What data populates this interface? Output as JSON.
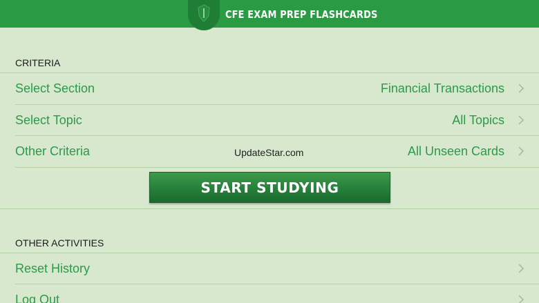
{
  "header": {
    "title": "CFE EXAM PREP FLASHCARDS",
    "logo_icon": "shield-logo-icon"
  },
  "criteria": {
    "heading": "CRITERIA",
    "rows": [
      {
        "label": "Select Section",
        "value": "Financial Transactions"
      },
      {
        "label": "Select Topic",
        "value": "All Topics"
      },
      {
        "label": "Other Criteria",
        "value": "All Unseen Cards"
      }
    ],
    "watermark": "UpdateStar.com",
    "start_button": "START STUDYING"
  },
  "other_activities": {
    "heading": "OTHER ACTIVITIES",
    "rows": [
      {
        "label": "Reset History"
      },
      {
        "label": "Log Out"
      }
    ]
  },
  "colors": {
    "header": "#2a9a43",
    "background": "#d7e8cf",
    "accent_text": "#2c9a48"
  }
}
